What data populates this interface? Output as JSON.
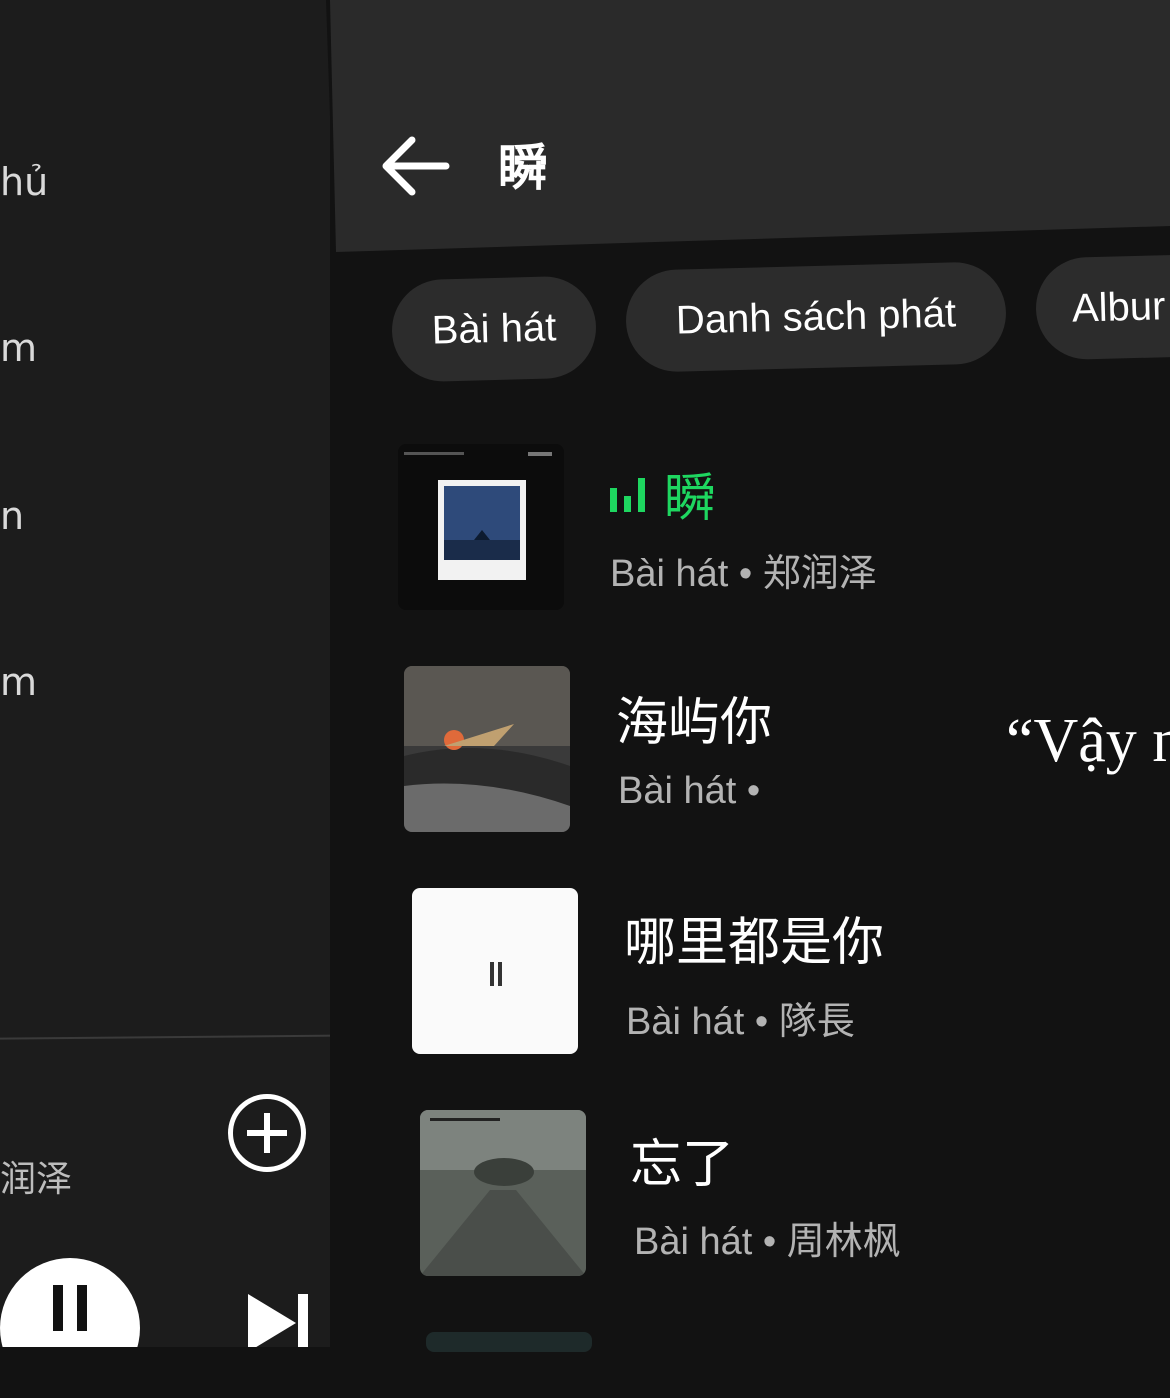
{
  "sidebar": {
    "items": [
      {
        "label": "hủ"
      },
      {
        "label": "m"
      },
      {
        "label": "n"
      },
      {
        "label": "m"
      }
    ]
  },
  "now_playing": {
    "artist_fragment": "润泽"
  },
  "header": {
    "title": "瞬"
  },
  "filters": [
    {
      "label": "Bài hát"
    },
    {
      "label": "Danh sách phát"
    },
    {
      "label": "Albur"
    }
  ],
  "results": [
    {
      "title": "瞬",
      "subtitle": "Bài hát • 郑润泽",
      "playing": true
    },
    {
      "title": "海屿你",
      "subtitle": "Bài hát • "
    },
    {
      "title": "哪里都是你",
      "subtitle": "Bài hát • 隊長"
    },
    {
      "title": "忘了",
      "subtitle": "Bài hát • 周林枫"
    }
  ],
  "overlay": {
    "quote": "“Vậy n"
  },
  "colors": {
    "accent": "#1ed760",
    "background": "#121212",
    "topbar": "#2a2a2a",
    "chip": "#2c2c2c"
  }
}
